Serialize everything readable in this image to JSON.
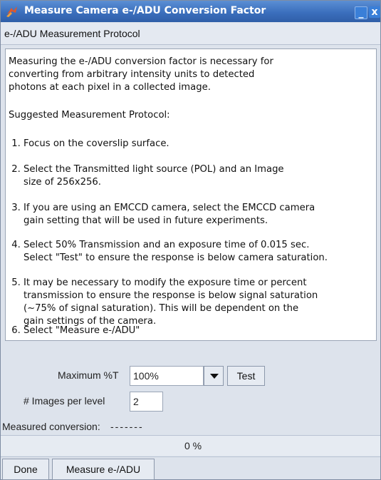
{
  "window": {
    "title": "Measure Camera e-/ADU Conversion Factor",
    "minimize_glyph": "_",
    "close_glyph": "x",
    "accent_color": "#3b6fbd"
  },
  "header": {
    "title": "e-/ADU Measurement Protocol"
  },
  "protocol": {
    "intro": "Measuring the e-/ADU conversion factor is necessary for\nconverting from arbitrary intensity units to detected\nphotons at each pixel in a collected image.",
    "heading": "Suggested Measurement Protocol:",
    "steps": [
      " 1. Focus on the coverslip surface.",
      " 2. Select the Transmitted light source (POL) and an Image\n     size of 256x256.",
      " 3. If you are using an EMCCD camera, select the EMCCD camera\n     gain setting that will be used in future experiments.",
      " 4. Select 50% Transmission and an exposure time of 0.015 sec.\n     Select \"Test\" to ensure the response is below camera saturation.",
      " 5. It may be necessary to modify the exposure time or percent\n     transmission to ensure the response is below signal saturation\n     (~75% of signal saturation). This will be dependent on the\n     gain settings of the camera.",
      " 6. Select \"Measure e-/ADU\""
    ]
  },
  "controls": {
    "max_t_label": "Maximum %T",
    "max_t_value": "100%",
    "test_label": "Test",
    "images_label": "# Images per level",
    "images_value": "2",
    "measured_label": "Measured conversion:",
    "measured_value": "-------",
    "progress_text": "0 %",
    "progress_fraction": 0
  },
  "footer": {
    "done_label": "Done",
    "measure_label": "Measure e-/ADU"
  }
}
